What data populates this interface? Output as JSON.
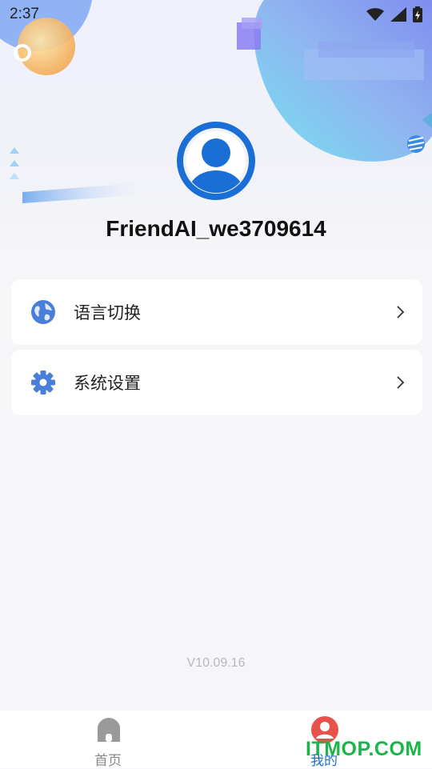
{
  "status_bar": {
    "time": "2:37"
  },
  "profile": {
    "username": "FriendAI_we3709614"
  },
  "menu": [
    {
      "label": "语言切换",
      "icon": "globe-icon"
    },
    {
      "label": "系统设置",
      "icon": "gear-icon"
    }
  ],
  "version": "V10.09.16",
  "tabs": [
    {
      "label": "首页",
      "icon": "home-icon",
      "active": false
    },
    {
      "label": "我的",
      "icon": "profile-icon",
      "active": true
    }
  ],
  "watermark": "ITMOP.COM",
  "colors": {
    "accent": "#1a6fd6",
    "active_tab": "#e7524a",
    "inactive_tab": "#8a8a8a",
    "watermark": "#1db54a"
  }
}
